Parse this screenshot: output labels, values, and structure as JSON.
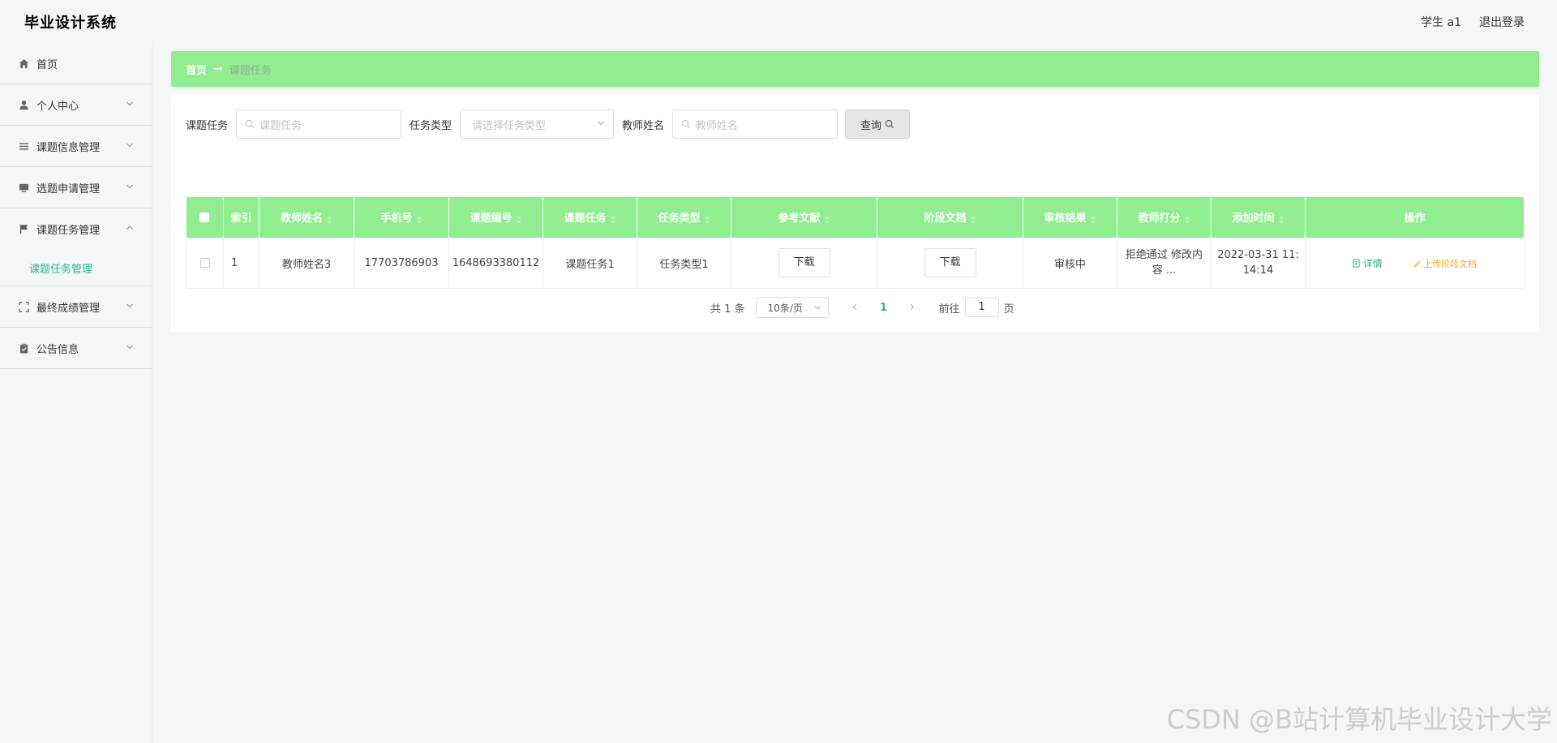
{
  "app": {
    "title": "毕业设计系统",
    "user_label": "学生 a1",
    "logout_label": "退出登录"
  },
  "sidebar": {
    "items": [
      {
        "label": "首页",
        "icon": "home-icon"
      },
      {
        "label": "个人中心",
        "icon": "user-icon"
      },
      {
        "label": "课题信息管理",
        "icon": "list-icon"
      },
      {
        "label": "选题申请管理",
        "icon": "monitor-icon"
      },
      {
        "label": "课题任务管理",
        "icon": "flag-icon"
      },
      {
        "label": "最终成绩管理",
        "icon": "fullscreen-icon"
      },
      {
        "label": "公告信息",
        "icon": "clipboard-icon"
      }
    ],
    "submenu": {
      "label": "课题任务管理"
    }
  },
  "breadcrumb": {
    "home": "首页",
    "arrow": "→",
    "current": "课题任务"
  },
  "search": {
    "task_label": "课题任务",
    "task_placeholder": "课题任务",
    "type_label": "任务类型",
    "type_placeholder": "请选择任务类型",
    "teacher_label": "教师姓名",
    "teacher_placeholder": "教师姓名",
    "button_label": "查询"
  },
  "table": {
    "headers": [
      "索引",
      "教师姓名",
      "手机号",
      "课题编号",
      "课题任务",
      "任务类型",
      "参考文献",
      "阶段文档",
      "审核结果",
      "教师打分",
      "添加时间",
      "操作"
    ],
    "rows": [
      {
        "index": "1",
        "teacher": "教师姓名3",
        "phone": "17703786903",
        "topic_no": "1648693380112",
        "task": "课题任务1",
        "type": "任务类型1",
        "ref_btn": "下载",
        "doc_btn": "下载",
        "audit": "审核中",
        "score_line1": "拒绝通过 修改内",
        "score_line2": "容 ...",
        "time_line1": "2022-03-31 11:",
        "time_line2": "14:14",
        "op_detail": "详情",
        "op_upload": "上传阶段文档"
      }
    ]
  },
  "pagination": {
    "total": "共 1 条",
    "page_size": "10条/页",
    "current": "1",
    "goto_label": "前往",
    "goto_value": "1",
    "page_suffix": "页"
  },
  "watermark": "CSDN @B站计算机毕业设计大学",
  "colors": {
    "accent": "#90ee90",
    "active_text": "#2cb5a0",
    "detail": "#2bb673",
    "upload": "#f5a623"
  }
}
